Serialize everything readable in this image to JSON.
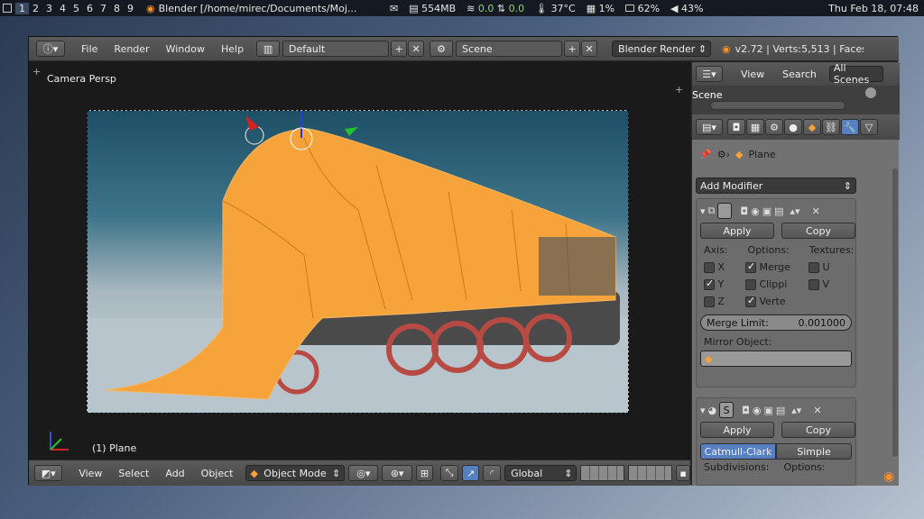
{
  "taskbar": {
    "workspaces": [
      "1",
      "2",
      "3",
      "4",
      "5",
      "6",
      "7",
      "8",
      "9"
    ],
    "window_title": "Blender [/home/mirec/Documents/Moj...",
    "memory": "554MB",
    "net_up": "0.0",
    "net_down": "0.0",
    "temperature": "37°C",
    "cpu": "1%",
    "battery": "62%",
    "volume": "43%",
    "clock": "Thu Feb 18, 07:48"
  },
  "menubar": {
    "menus": [
      "File",
      "Render",
      "Window",
      "Help"
    ],
    "layout": "Default",
    "scene": "Scene",
    "engine": "Blender Render",
    "stats": "v2.72 | Verts:5,513 | Faces"
  },
  "viewport": {
    "view_label": "Camera Persp",
    "object_label": "(1) Plane"
  },
  "bottombar": {
    "menus": [
      "View",
      "Select",
      "Add",
      "Object"
    ],
    "mode": "Object Mode",
    "orientation": "Global"
  },
  "outliner": {
    "tabs": [
      "View",
      "Search",
      "All Scenes"
    ],
    "item": "Scene"
  },
  "properties": {
    "context_object": "Plane",
    "add_modifier": "Add Modifier",
    "mirror": {
      "apply": "Apply",
      "copy": "Copy",
      "axis_label": "Axis:",
      "options_label": "Options:",
      "textures_label": "Textures:",
      "axes": [
        {
          "label": "X",
          "checked": false
        },
        {
          "label": "Y",
          "checked": true
        },
        {
          "label": "Z",
          "checked": false
        }
      ],
      "options": [
        {
          "label": "Merge",
          "checked": true
        },
        {
          "label": "Clippi",
          "checked": false
        },
        {
          "label": "Verte",
          "checked": true
        }
      ],
      "textures": [
        {
          "label": "U",
          "checked": false
        },
        {
          "label": "V",
          "checked": false
        }
      ],
      "merge_limit_label": "Merge Limit:",
      "merge_limit_value": "0.001000",
      "mirror_object_label": "Mirror Object:"
    },
    "subsurf": {
      "name": "S",
      "apply": "Apply",
      "copy": "Copy",
      "type_catmull": "Catmull-Clark",
      "type_simple": "Simple",
      "subdivisions_label": "Subdivisions:",
      "options_label": "Options:"
    }
  }
}
